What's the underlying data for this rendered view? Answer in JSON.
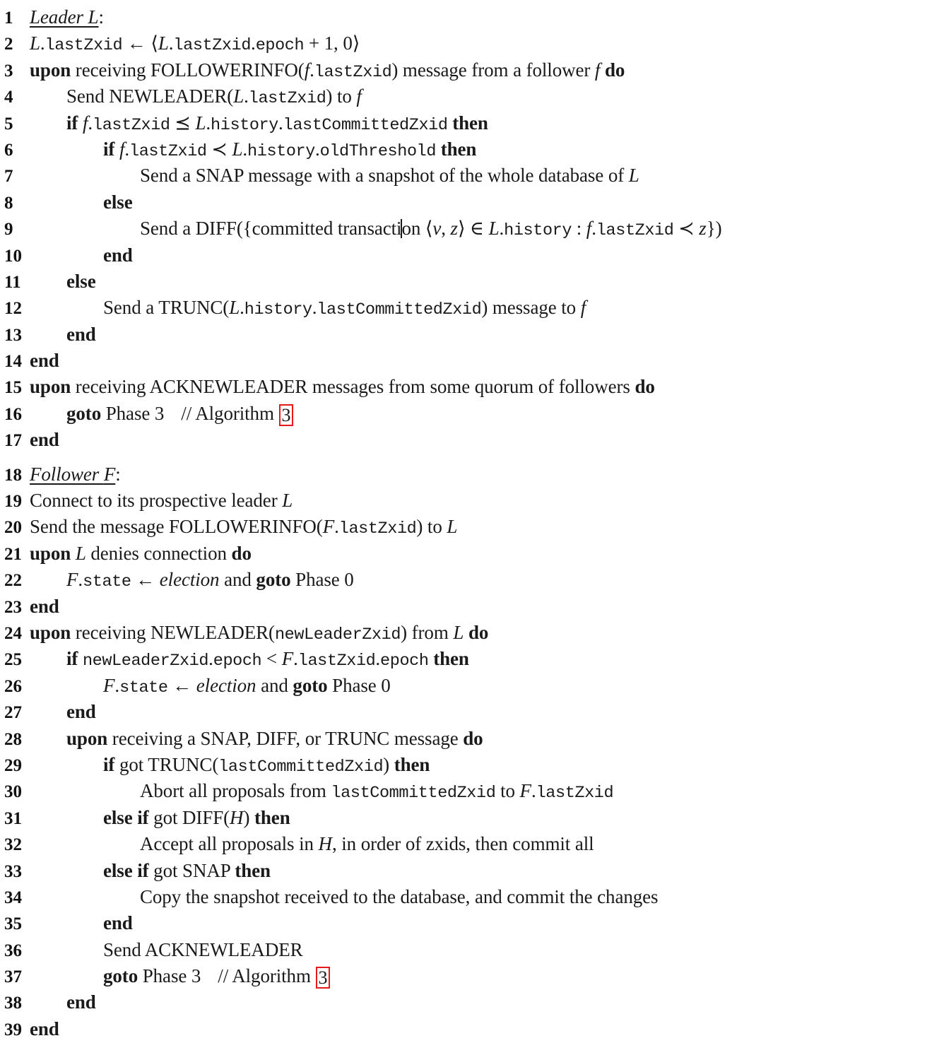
{
  "document": {
    "kind": "algorithm-pseudocode",
    "title_visible": false,
    "accent_ref_color": "#e51a1a"
  },
  "sections": [
    {
      "id": "leader",
      "heading": "Leader L:",
      "heading_variable": "L"
    },
    {
      "id": "follower",
      "heading": "Follower F:",
      "heading_variable": "F"
    }
  ],
  "lines": [
    {
      "n": "1",
      "indent": 0,
      "text": "Leader L:"
    },
    {
      "n": "2",
      "indent": 0,
      "text": "L.lastZxid ← ⟨L.lastZxid.epoch + 1, 0⟩"
    },
    {
      "n": "3",
      "indent": 0,
      "text": "upon receiving FOLLOWERINFO(f.lastZxid) message from a follower f do"
    },
    {
      "n": "4",
      "indent": 1,
      "text": "Send NEWLEADER(L.lastZxid) to f"
    },
    {
      "n": "5",
      "indent": 1,
      "text": "if f.lastZxid ⪯ L.history.lastCommittedZxid then"
    },
    {
      "n": "6",
      "indent": 2,
      "text": "if f.lastZxid ≺ L.history.oldThreshold then"
    },
    {
      "n": "7",
      "indent": 3,
      "text": "Send a SNAP message with a snapshot of the whole database of L"
    },
    {
      "n": "8",
      "indent": 2,
      "text": "else"
    },
    {
      "n": "9",
      "indent": 3,
      "text": "Send a DIFF({committed transaction ⟨v, z⟩ ∈ L.history : f.lastZxid ≺ z})"
    },
    {
      "n": "10",
      "indent": 2,
      "text": "end"
    },
    {
      "n": "11",
      "indent": 1,
      "text": "else"
    },
    {
      "n": "12",
      "indent": 2,
      "text": "Send a TRUNC(L.history.lastCommittedZxid) message to f"
    },
    {
      "n": "13",
      "indent": 1,
      "text": "end"
    },
    {
      "n": "14",
      "indent": 0,
      "text": "end"
    },
    {
      "n": "15",
      "indent": 0,
      "text": "upon receiving ACKNEWLEADER messages from some quorum of followers do"
    },
    {
      "n": "16",
      "indent": 1,
      "text": "goto Phase 3    // Algorithm 3"
    },
    {
      "n": "17",
      "indent": 0,
      "text": "end"
    },
    {
      "n": "18",
      "indent": 0,
      "text": "Follower F:"
    },
    {
      "n": "19",
      "indent": 0,
      "text": "Connect to its prospective leader L"
    },
    {
      "n": "20",
      "indent": 0,
      "text": "Send the message FOLLOWERINFO(F.lastZxid) to L"
    },
    {
      "n": "21",
      "indent": 0,
      "text": "upon L denies connection do"
    },
    {
      "n": "22",
      "indent": 1,
      "text": "F.state ← election and goto Phase 0"
    },
    {
      "n": "23",
      "indent": 0,
      "text": "end"
    },
    {
      "n": "24",
      "indent": 0,
      "text": "upon receiving NEWLEADER(newLeaderZxid) from L do"
    },
    {
      "n": "25",
      "indent": 1,
      "text": "if newLeaderZxid.epoch < F.lastZxid.epoch then"
    },
    {
      "n": "26",
      "indent": 2,
      "text": "F.state ← election and goto Phase 0"
    },
    {
      "n": "27",
      "indent": 1,
      "text": "end"
    },
    {
      "n": "28",
      "indent": 1,
      "text": "upon receiving a SNAP, DIFF, or TRUNC message do"
    },
    {
      "n": "29",
      "indent": 2,
      "text": "if got TRUNC(lastCommittedZxid) then"
    },
    {
      "n": "30",
      "indent": 3,
      "text": "Abort all proposals from lastCommittedZxid to F.lastZxid"
    },
    {
      "n": "31",
      "indent": 2,
      "text": "else if got DIFF(H) then"
    },
    {
      "n": "32",
      "indent": 3,
      "text": "Accept all proposals in H, in order of zxids, then commit all"
    },
    {
      "n": "33",
      "indent": 2,
      "text": "else if got SNAP then"
    },
    {
      "n": "34",
      "indent": 3,
      "text": "Copy the snapshot received to the database, and commit the changes"
    },
    {
      "n": "35",
      "indent": 2,
      "text": "end"
    },
    {
      "n": "36",
      "indent": 2,
      "text": "Send ACKNEWLEADER"
    },
    {
      "n": "37",
      "indent": 2,
      "text": "goto Phase 3    // Algorithm 3"
    },
    {
      "n": "38",
      "indent": 1,
      "text": "end"
    },
    {
      "n": "39",
      "indent": 0,
      "text": "end"
    }
  ],
  "keywords": [
    "upon",
    "do",
    "if",
    "then",
    "else",
    "end",
    "goto"
  ],
  "messages": [
    "FOLLOWERINFO",
    "NEWLEADER",
    "ACKNEWLEADER",
    "SNAP",
    "DIFF",
    "TRUNC"
  ],
  "references": [
    {
      "on_line": "16",
      "label": "3",
      "comment": "// Algorithm 3"
    },
    {
      "on_line": "37",
      "label": "3",
      "comment": "// Algorithm 3"
    }
  ],
  "variables": {
    "leader": "L",
    "follower_upper": "F",
    "follower_lower": "f",
    "history_set": "H",
    "value": "v",
    "zxid": "z"
  }
}
